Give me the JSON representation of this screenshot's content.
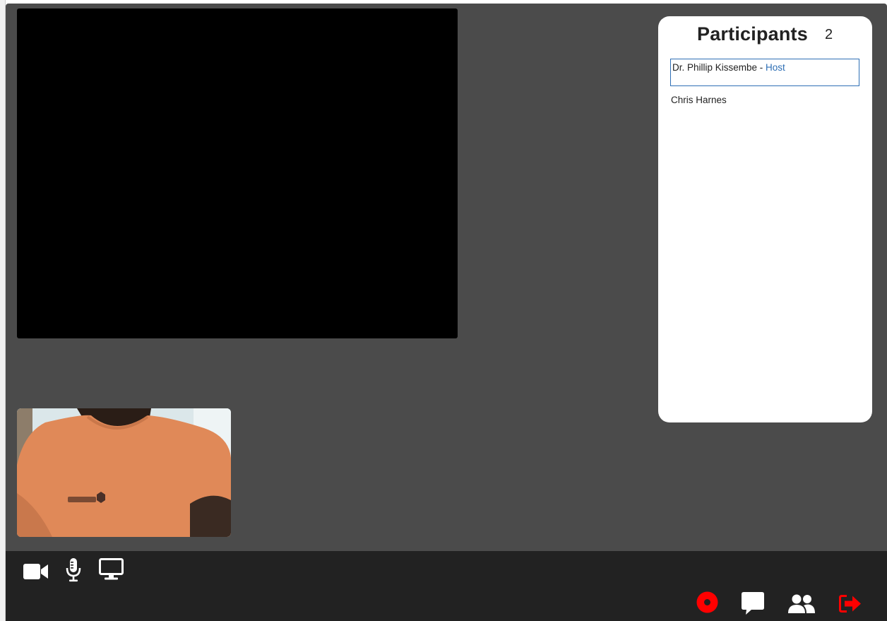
{
  "participants_panel": {
    "title": "Participants",
    "count": "2",
    "participants": [
      {
        "name": "Dr. Phillip Kissembe",
        "separator": " - ",
        "role": "Host"
      },
      {
        "name": "Chris Harnes"
      }
    ]
  },
  "toolbar": {
    "left_controls": [
      "video-camera-icon",
      "microphone-icon",
      "screen-share-icon"
    ],
    "right_controls": [
      "record-icon",
      "chat-icon",
      "participants-icon",
      "leave-icon"
    ]
  },
  "colors": {
    "background": "#4b4b4b",
    "toolbar": "#222222",
    "host_accent": "#2e6fb5",
    "danger": "#ff0000",
    "panel": "#ffffff"
  }
}
